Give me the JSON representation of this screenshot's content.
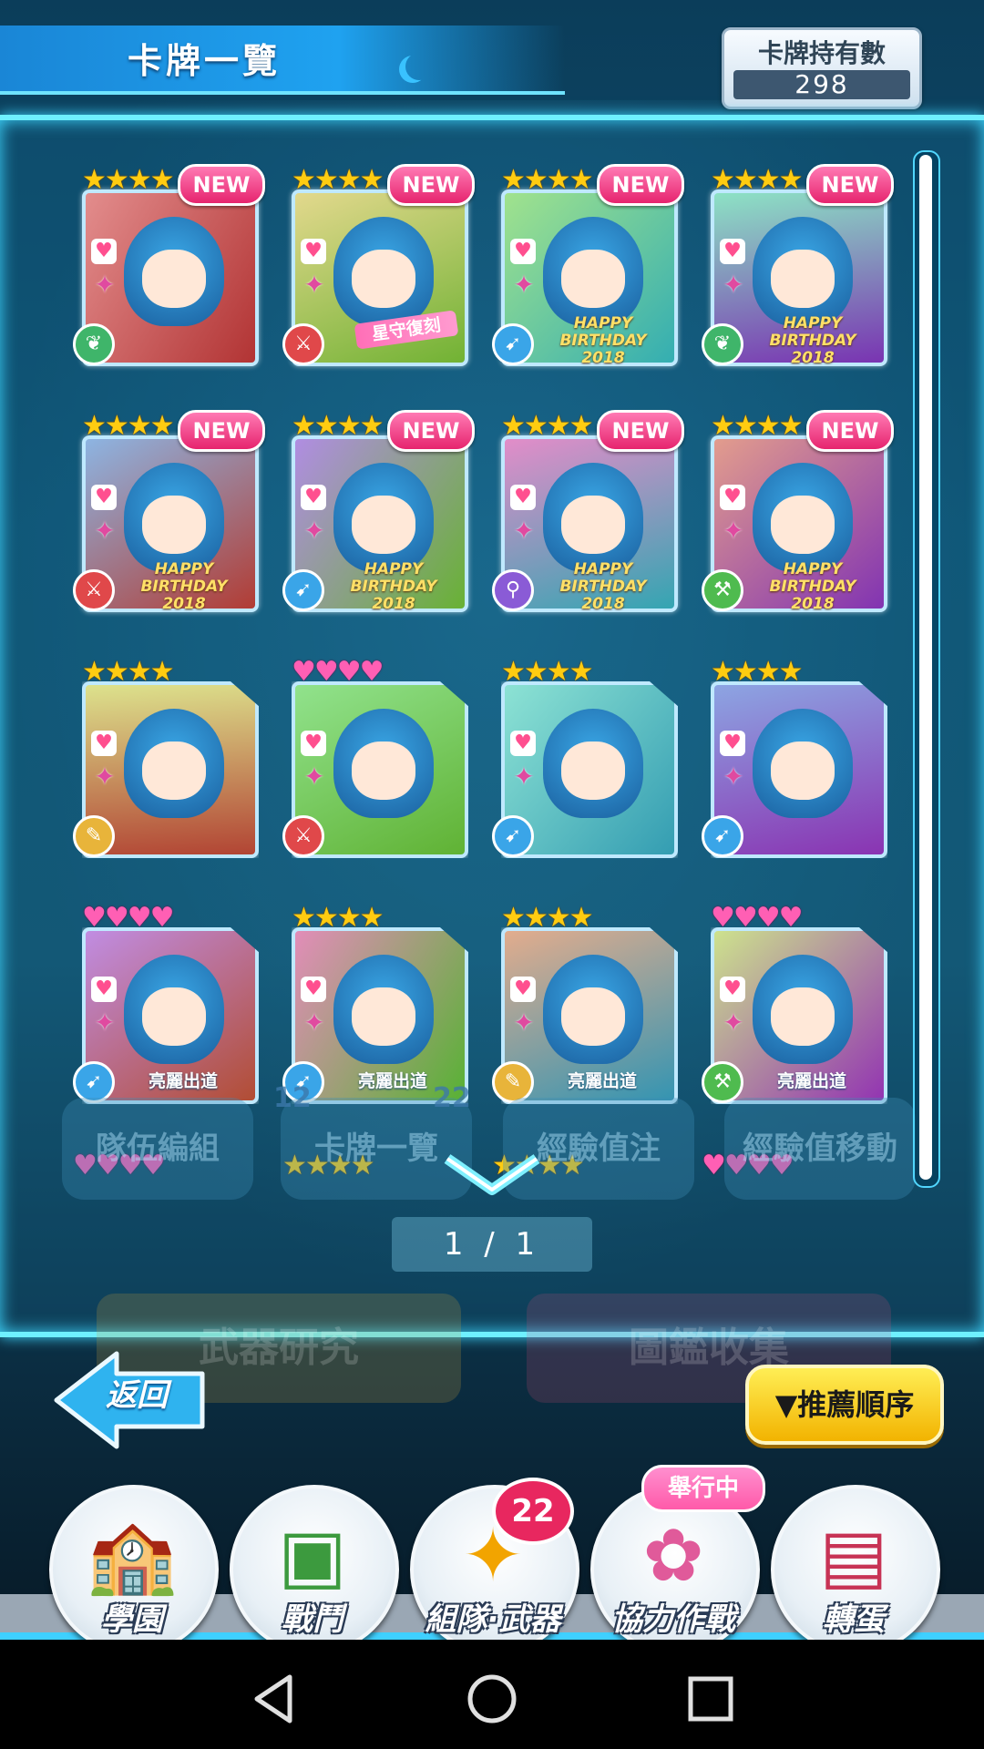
{
  "header": {
    "title": "卡牌一覽",
    "owned_label": "卡牌持有數",
    "owned_count": "298"
  },
  "cards": [
    {
      "stars": "★★★★",
      "star_color": "gold",
      "new": "NEW",
      "attr": "wind",
      "tag": ""
    },
    {
      "stars": "★★★★",
      "star_color": "gold",
      "new": "NEW",
      "attr": "blade",
      "tag": "星守復刻"
    },
    {
      "stars": "★★★★",
      "star_color": "gold",
      "new": "NEW",
      "attr": "gun",
      "tag": "HAPPY BIRTHDAY 2018"
    },
    {
      "stars": "★★★★",
      "star_color": "gold",
      "new": "NEW",
      "attr": "wind",
      "tag": "HAPPY BIRTHDAY 2018"
    },
    {
      "stars": "★★★★",
      "star_color": "gold",
      "new": "NEW",
      "attr": "blade",
      "tag": "HAPPY BIRTHDAY 2018"
    },
    {
      "stars": "★★★★",
      "star_color": "gold",
      "new": "NEW",
      "attr": "gun",
      "tag": "HAPPY BIRTHDAY 2018"
    },
    {
      "stars": "★★★★",
      "star_color": "gold",
      "new": "NEW",
      "attr": "staff",
      "tag": "HAPPY BIRTHDAY 2018"
    },
    {
      "stars": "★★★★",
      "star_color": "gold",
      "new": "NEW",
      "attr": "hammer",
      "tag": "HAPPY BIRTHDAY 2018"
    },
    {
      "stars": "★★★★",
      "star_color": "gold",
      "new": "",
      "attr": "brush",
      "tag": ""
    },
    {
      "stars": "♥♥♥♥",
      "star_color": "pink",
      "new": "",
      "attr": "blade",
      "tag": ""
    },
    {
      "stars": "★★★★",
      "star_color": "gold",
      "new": "",
      "attr": "gun",
      "tag": ""
    },
    {
      "stars": "★★★★",
      "star_color": "gold",
      "new": "",
      "attr": "gun",
      "tag": ""
    },
    {
      "stars": "♥♥♥♥",
      "star_color": "pink",
      "new": "",
      "attr": "gun",
      "tag": "亮麗出道"
    },
    {
      "stars": "★★★★",
      "star_color": "gold",
      "new": "",
      "attr": "gun",
      "tag": "亮麗出道"
    },
    {
      "stars": "★★★★",
      "star_color": "gold",
      "new": "",
      "attr": "brush",
      "tag": "亮麗出道"
    },
    {
      "stars": "♥♥♥♥",
      "star_color": "pink",
      "new": "",
      "attr": "hammer",
      "tag": "亮麗出道"
    }
  ],
  "partial_row": [
    {
      "stars": "♥♥♥♥"
    },
    {
      "stars": "★★★★"
    },
    {
      "stars": "★★★★"
    },
    {
      "stars": "♥♥♥♥"
    }
  ],
  "faded_menu": [
    "隊伍編組",
    "卡牌一覽",
    "經驗值注",
    "經驗值移動"
  ],
  "faded_counts": [
    "12",
    "22"
  ],
  "ghost_buttons": [
    "武器研究",
    "圖鑑收集"
  ],
  "pager": "1 / 1",
  "back_label": "返回",
  "sort_label": "▼推薦順序",
  "nav": [
    {
      "label": "學園",
      "icon": "school-icon"
    },
    {
      "label": "戰鬥",
      "icon": "battle-icon"
    },
    {
      "label": "組隊·武器",
      "icon": "team-weapon-icon"
    },
    {
      "label": "協力作戰",
      "icon": "coop-icon"
    },
    {
      "label": "轉蛋",
      "icon": "gacha-icon"
    }
  ],
  "nav_badge": "22",
  "event_tag": "舉行中",
  "colors": {
    "accent": "#6ff0ff",
    "gold": "#ffcc11",
    "pink": "#ff5fb4",
    "new_badge": "#e6246e",
    "sort_button": "#f2b300"
  }
}
